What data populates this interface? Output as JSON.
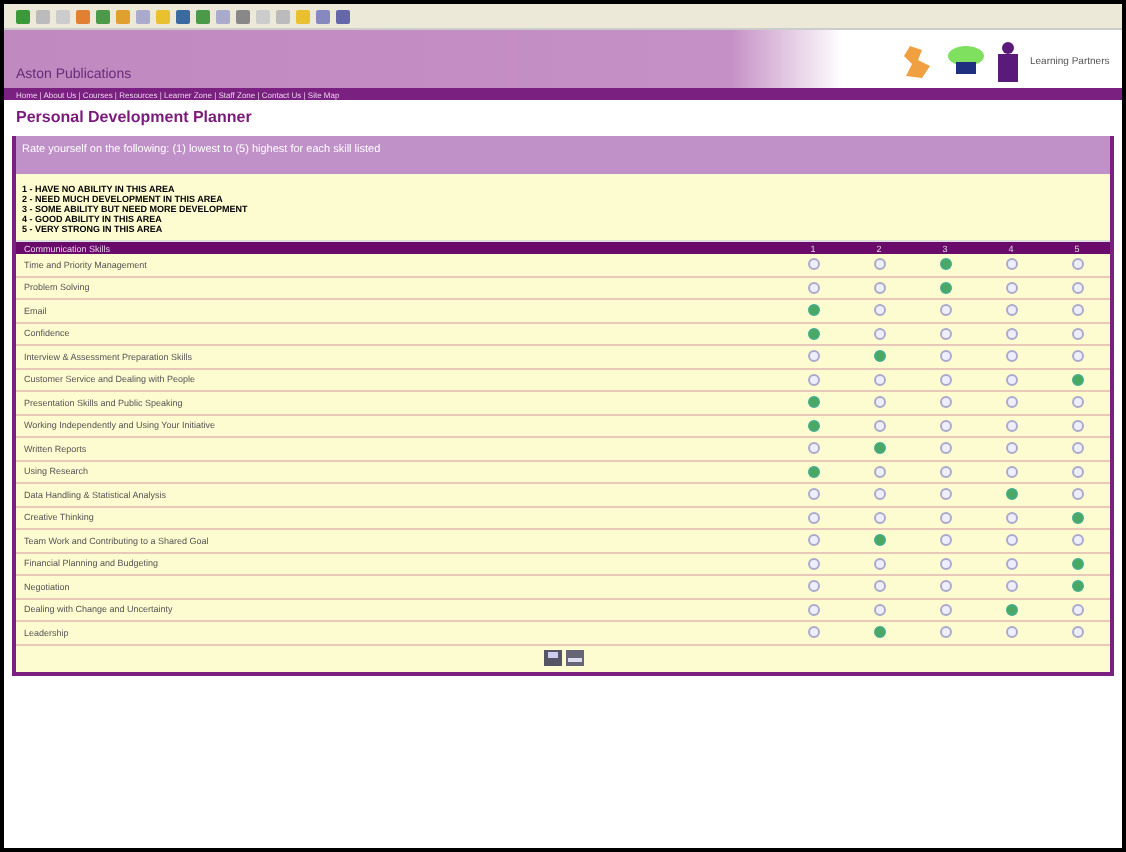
{
  "banner": {
    "title": "Aston Publications",
    "nav": "Home | About Us | Courses | Resources | Learner Zone | Staff Zone | Contact Us | Site Map",
    "logo_text": "Learning Partners"
  },
  "page": {
    "title": "Personal Development Planner",
    "intro": "Rate yourself on the following: (1) lowest to (5) highest for each skill listed",
    "legend": [
      "1 - HAVE NO ABILITY IN THIS AREA",
      "2 - NEED MUCH DEVELOPMENT IN THIS AREA",
      "3 - SOME ABILITY BUT NEED MORE DEVELOPMENT",
      "4 - GOOD ABILITY IN THIS AREA",
      "5 - VERY STRONG IN THIS AREA"
    ]
  },
  "table": {
    "heading": "Communication Skills",
    "columns": [
      "1",
      "2",
      "3",
      "4",
      "5"
    ],
    "rows": [
      {
        "label": "Time and Priority Management",
        "choices": [
          {
            "selected": false
          },
          {
            "selected": false
          },
          {
            "selected": true
          },
          {
            "selected": false
          },
          {
            "selected": false
          }
        ]
      },
      {
        "label": "Problem Solving",
        "choices": [
          {
            "selected": false
          },
          {
            "selected": false
          },
          {
            "selected": true
          },
          {
            "selected": false
          },
          {
            "selected": false
          }
        ]
      },
      {
        "label": "Email",
        "choices": [
          {
            "selected": true
          },
          {
            "selected": false
          },
          {
            "selected": false
          },
          {
            "selected": false
          },
          {
            "selected": false
          }
        ]
      },
      {
        "label": "Confidence",
        "choices": [
          {
            "selected": true
          },
          {
            "selected": false
          },
          {
            "selected": false
          },
          {
            "selected": false
          },
          {
            "selected": false
          }
        ]
      },
      {
        "label": "Interview & Assessment Preparation Skills",
        "choices": [
          {
            "selected": false
          },
          {
            "selected": true
          },
          {
            "selected": false
          },
          {
            "selected": false
          },
          {
            "selected": false
          }
        ]
      },
      {
        "label": "Customer Service and Dealing with People",
        "choices": [
          {
            "selected": false
          },
          {
            "selected": false
          },
          {
            "selected": false
          },
          {
            "selected": false
          },
          {
            "selected": true
          }
        ]
      },
      {
        "label": "Presentation Skills and Public Speaking",
        "choices": [
          {
            "selected": true
          },
          {
            "selected": false
          },
          {
            "selected": false
          },
          {
            "selected": false
          },
          {
            "selected": false
          }
        ]
      },
      {
        "label": "Working Independently and Using Your Initiative",
        "choices": [
          {
            "selected": true
          },
          {
            "selected": false
          },
          {
            "selected": false
          },
          {
            "selected": false
          },
          {
            "selected": false
          }
        ]
      },
      {
        "label": "Written Reports",
        "choices": [
          {
            "selected": false
          },
          {
            "selected": true
          },
          {
            "selected": false
          },
          {
            "selected": false
          },
          {
            "selected": false
          }
        ]
      },
      {
        "label": "Using Research",
        "choices": [
          {
            "selected": true
          },
          {
            "selected": false
          },
          {
            "selected": false
          },
          {
            "selected": false
          },
          {
            "selected": false
          }
        ]
      },
      {
        "label": "Data Handling & Statistical Analysis",
        "choices": [
          {
            "selected": false
          },
          {
            "selected": false
          },
          {
            "selected": false
          },
          {
            "selected": true
          },
          {
            "selected": false
          }
        ]
      },
      {
        "label": "Creative Thinking",
        "choices": [
          {
            "selected": false
          },
          {
            "selected": false
          },
          {
            "selected": false
          },
          {
            "selected": false
          },
          {
            "selected": true
          }
        ]
      },
      {
        "label": "Team Work and Contributing to a Shared Goal",
        "choices": [
          {
            "selected": false
          },
          {
            "selected": true
          },
          {
            "selected": false
          },
          {
            "selected": false
          },
          {
            "selected": false
          }
        ]
      },
      {
        "label": "Financial Planning and Budgeting",
        "choices": [
          {
            "selected": false
          },
          {
            "selected": false
          },
          {
            "selected": false
          },
          {
            "selected": false
          },
          {
            "selected": true
          }
        ]
      },
      {
        "label": "Negotiation",
        "choices": [
          {
            "selected": false
          },
          {
            "selected": false
          },
          {
            "selected": false
          },
          {
            "selected": false
          },
          {
            "selected": true
          }
        ]
      },
      {
        "label": "Dealing with Change and Uncertainty",
        "choices": [
          {
            "selected": false
          },
          {
            "selected": false
          },
          {
            "selected": false
          },
          {
            "selected": true
          },
          {
            "selected": false
          }
        ]
      },
      {
        "label": "Leadership",
        "choices": [
          {
            "selected": false
          },
          {
            "selected": true
          },
          {
            "selected": false
          },
          {
            "selected": false
          },
          {
            "selected": false
          }
        ]
      }
    ]
  }
}
